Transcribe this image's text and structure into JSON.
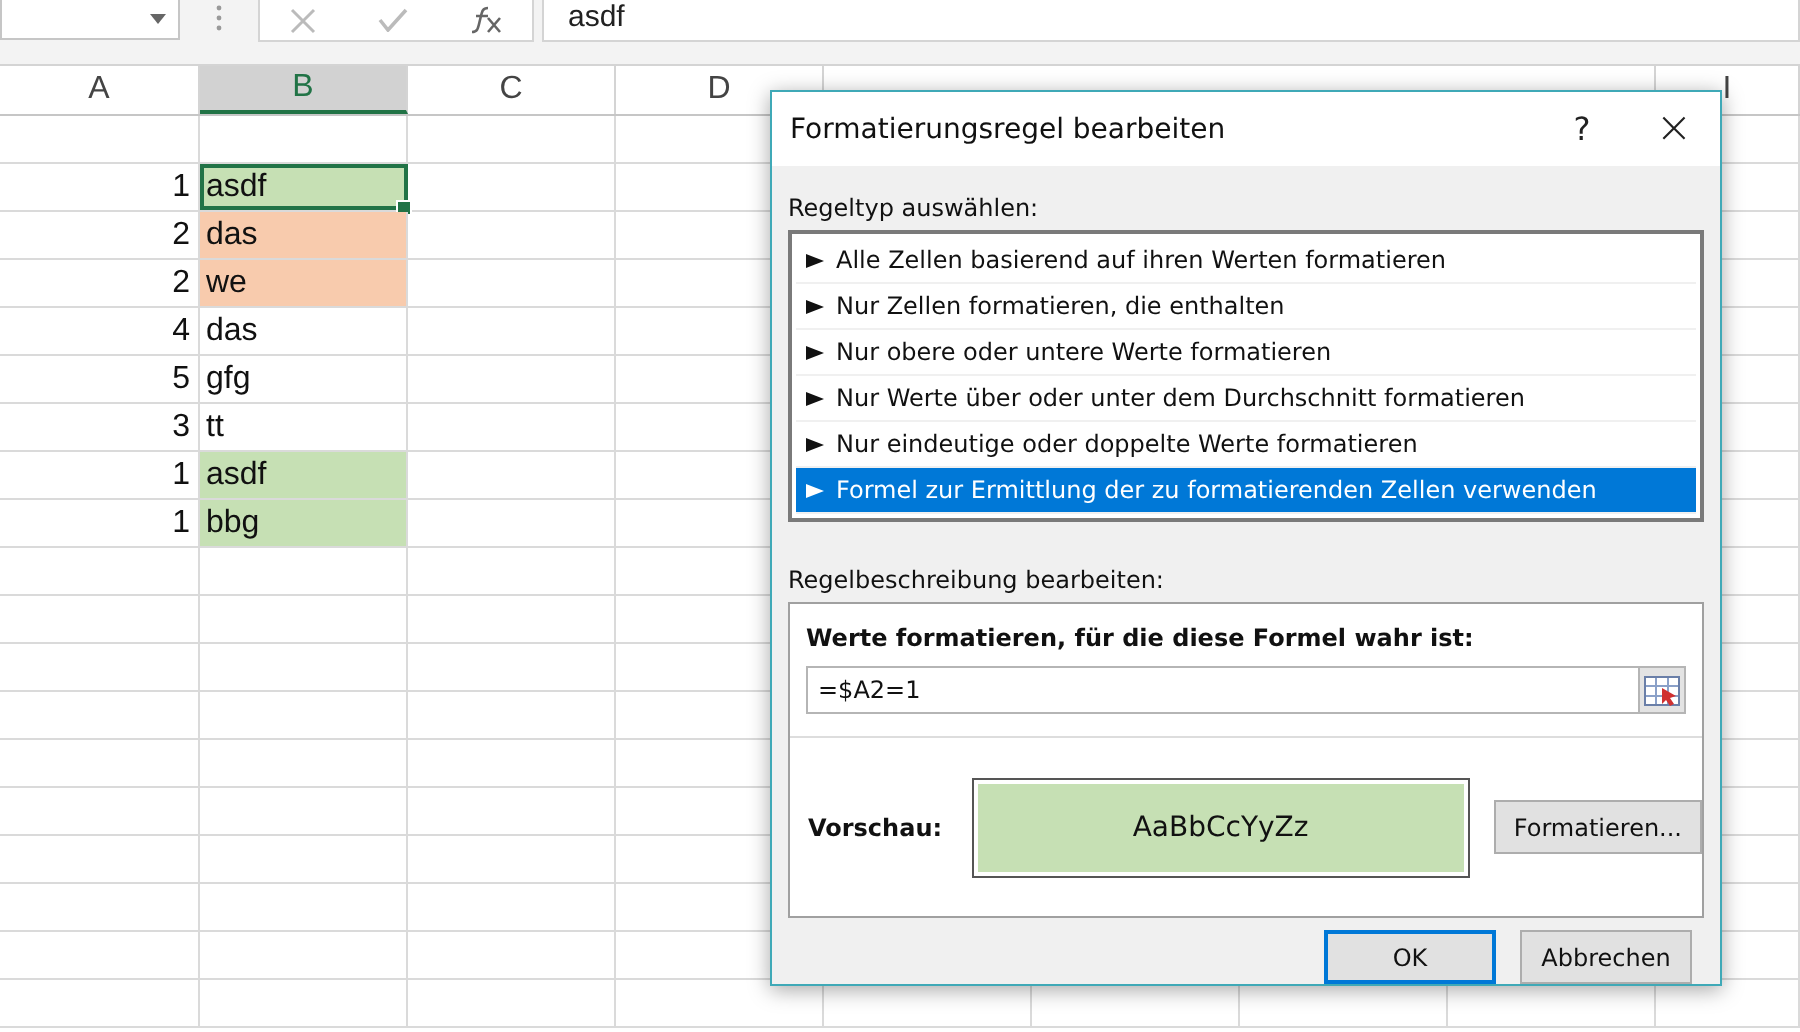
{
  "formula_bar": {
    "value": "asdf"
  },
  "columns": [
    {
      "label": "A",
      "selected": false
    },
    {
      "label": "B",
      "selected": true
    },
    {
      "label": "C",
      "selected": false
    },
    {
      "label": "D",
      "selected": false
    },
    {
      "label": "I",
      "selected": false
    }
  ],
  "rows": [
    {
      "a": "1",
      "b": "asdf",
      "color": "#c6e0b4",
      "selected": true
    },
    {
      "a": "2",
      "b": "das",
      "color": "#f8cbad",
      "selected": false
    },
    {
      "a": "2",
      "b": "we",
      "color": "#f8cbad",
      "selected": false
    },
    {
      "a": "4",
      "b": "das",
      "selected": false
    },
    {
      "a": "5",
      "b": "gfg",
      "selected": false
    },
    {
      "a": "3",
      "b": "tt",
      "selected": false
    },
    {
      "a": "1",
      "b": "asdf",
      "color": "#c6e0b4",
      "selected": false
    },
    {
      "a": "1",
      "b": "bbg",
      "color": "#c6e0b4",
      "selected": false
    }
  ],
  "dialog": {
    "title": "Formatierungsregel bearbeiten",
    "help": "?",
    "close": "×",
    "rule_type_label": "Regeltyp auswählen:",
    "rule_types": [
      {
        "label": "Alle Zellen basierend auf ihren Werten formatieren",
        "selected": false
      },
      {
        "label": "Nur Zellen formatieren, die enthalten",
        "selected": false
      },
      {
        "label": "Nur obere oder untere Werte formatieren",
        "selected": false
      },
      {
        "label": "Nur Werte über oder unter dem Durchschnitt formatieren",
        "selected": false
      },
      {
        "label": "Nur eindeutige oder doppelte Werte formatieren",
        "selected": false
      },
      {
        "label": "Formel zur Ermittlung der zu formatierenden Zellen verwenden",
        "selected": true
      }
    ],
    "description_label": "Regelbeschreibung bearbeiten:",
    "formula_label": "Werte formatieren, für die diese Formel wahr ist:",
    "formula": "=$A2=1",
    "preview_label": "Vorschau:",
    "preview": {
      "text": "AaBbCcYyZz",
      "color": "#c6e0b4"
    },
    "format_button": "Formatieren...",
    "buttons": [
      {
        "label": "OK",
        "selected": true
      },
      {
        "label": "Abbrechen",
        "selected": false
      }
    ]
  }
}
